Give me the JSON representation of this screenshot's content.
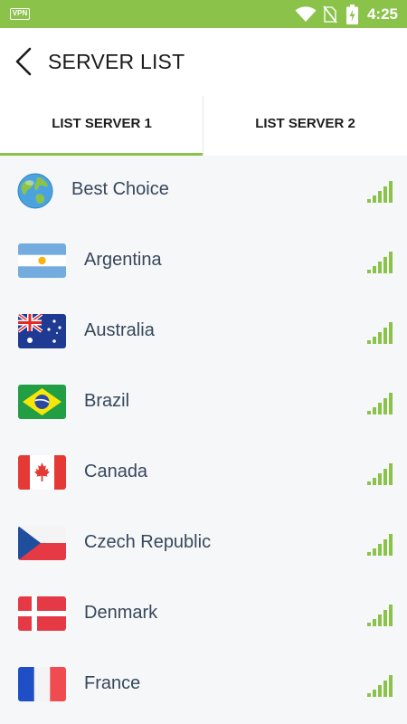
{
  "status_bar": {
    "vpn_badge": "VPN",
    "time": "4:25",
    "icons": [
      "wifi-icon",
      "no-sim-icon",
      "battery-charging-icon"
    ]
  },
  "header": {
    "title": "SERVER LIST",
    "back_icon": "chevron-left-icon"
  },
  "tabs": [
    {
      "label": "LIST SERVER 1",
      "active": true
    },
    {
      "label": "LIST SERVER 2",
      "active": false
    }
  ],
  "servers": [
    {
      "name": "Best Choice",
      "icon": "globe-icon",
      "signal": "full"
    },
    {
      "name": "Argentina",
      "icon": "argentina-flag-icon",
      "signal": "full"
    },
    {
      "name": "Australia",
      "icon": "australia-flag-icon",
      "signal": "full"
    },
    {
      "name": "Brazil",
      "icon": "brazil-flag-icon",
      "signal": "full"
    },
    {
      "name": "Canada",
      "icon": "canada-flag-icon",
      "signal": "full"
    },
    {
      "name": "Czech Republic",
      "icon": "czech-flag-icon",
      "signal": "full"
    },
    {
      "name": "Denmark",
      "icon": "denmark-flag-icon",
      "signal": "full"
    },
    {
      "name": "France",
      "icon": "france-flag-icon",
      "signal": "full"
    }
  ],
  "colors": {
    "accent": "#8bc34a",
    "text_primary": "#1b1b1b",
    "country_text": "#37475a",
    "list_background": "#f6f7f9"
  }
}
